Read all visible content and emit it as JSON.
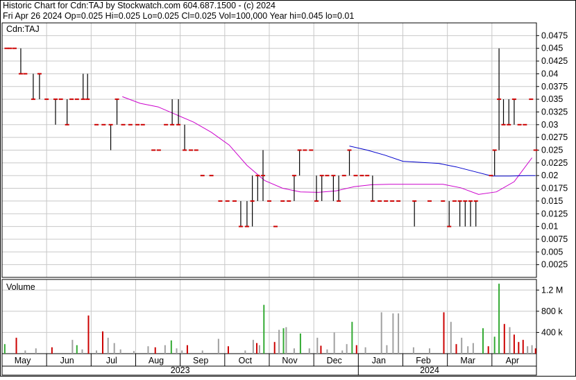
{
  "header": {
    "line1": "Historic Chart for Cdn:TAJ by Stockwatch.com 604.687.1500 - (c) 2024",
    "line2": "Fri Apr 26 2024   Op=0.025  Hi=0.025  Lo=0.025  Cl=0.025  Vol=100,000  Year hi=0.045  lo=0.01"
  },
  "price_panel_label": "Cdn:TAJ",
  "volume_panel_label": "Volume",
  "colors": {
    "up_tick": "#000000",
    "close_tick": "#cc0000",
    "ma_short": "#cc00cc",
    "ma_long": "#0000cc",
    "vol_up": "#33aa33",
    "vol_down": "#cc0000",
    "vol_flat": "#a0a0a0",
    "grid": "#c8c8c8"
  },
  "chart_data": [
    {
      "type": "ohlc",
      "title": "Historic Chart for Cdn:TAJ",
      "ylim": [
        0,
        0.05
      ],
      "y_ticks": [
        "0.0475",
        "0.045",
        "0.0425",
        "0.04",
        "0.0375",
        "0.035",
        "0.0325",
        "0.03",
        "0.0275",
        "0.025",
        "0.0225",
        "0.02",
        "0.0175",
        "0.015",
        "0.0125",
        "0.01",
        "0.0075",
        "0.005",
        "0.0025"
      ],
      "x_months": [
        "May",
        "Jun",
        "Jul",
        "Aug",
        "Sep",
        "Oct",
        "Nov",
        "Dec",
        "Jan",
        "Feb",
        "Mar",
        "Apr"
      ],
      "x_years": [
        "2023",
        "2024"
      ],
      "bars": [
        {
          "t": 0.5,
          "hi": 0.045,
          "lo": 0.045,
          "cl": 0.045
        },
        {
          "t": 0.9,
          "hi": 0.045,
          "lo": 0.045,
          "cl": 0.045
        },
        {
          "t": 1.4,
          "hi": 0.045,
          "lo": 0.045,
          "cl": 0.045
        },
        {
          "t": 2.1,
          "hi": 0.045,
          "lo": 0.04,
          "cl": 0.04
        },
        {
          "t": 2.6,
          "hi": 0.04,
          "lo": 0.04,
          "cl": 0.04
        },
        {
          "t": 3.5,
          "hi": 0.04,
          "lo": 0.035,
          "cl": 0.035
        },
        {
          "t": 4.2,
          "hi": 0.04,
          "lo": 0.035,
          "cl": 0.04
        },
        {
          "t": 5.0,
          "hi": 0.035,
          "lo": 0.035,
          "cl": 0.035
        },
        {
          "t": 6.0,
          "hi": 0.035,
          "lo": 0.03,
          "cl": 0.035
        },
        {
          "t": 6.6,
          "hi": 0.035,
          "lo": 0.035,
          "cl": 0.035
        },
        {
          "t": 7.3,
          "hi": 0.035,
          "lo": 0.03,
          "cl": 0.03
        },
        {
          "t": 7.8,
          "hi": 0.035,
          "lo": 0.035,
          "cl": 0.035
        },
        {
          "t": 8.4,
          "hi": 0.035,
          "lo": 0.035,
          "cl": 0.035
        },
        {
          "t": 9.1,
          "hi": 0.04,
          "lo": 0.035,
          "cl": 0.035
        },
        {
          "t": 9.6,
          "hi": 0.04,
          "lo": 0.035,
          "cl": 0.035
        },
        {
          "t": 10.6,
          "hi": 0.03,
          "lo": 0.03,
          "cl": 0.03
        },
        {
          "t": 11.4,
          "hi": 0.03,
          "lo": 0.03,
          "cl": 0.03
        },
        {
          "t": 12.2,
          "hi": 0.03,
          "lo": 0.025,
          "cl": 0.03
        },
        {
          "t": 12.9,
          "hi": 0.035,
          "lo": 0.03,
          "cl": 0.035
        },
        {
          "t": 13.6,
          "hi": 0.03,
          "lo": 0.03,
          "cl": 0.03
        },
        {
          "t": 14.4,
          "hi": 0.03,
          "lo": 0.03,
          "cl": 0.03
        },
        {
          "t": 15.2,
          "hi": 0.03,
          "lo": 0.03,
          "cl": 0.03
        },
        {
          "t": 15.8,
          "hi": 0.03,
          "lo": 0.03,
          "cl": 0.03
        },
        {
          "t": 17.0,
          "hi": 0.025,
          "lo": 0.025,
          "cl": 0.025
        },
        {
          "t": 17.6,
          "hi": 0.025,
          "lo": 0.025,
          "cl": 0.025
        },
        {
          "t": 18.4,
          "hi": 0.03,
          "lo": 0.03,
          "cl": 0.03
        },
        {
          "t": 19.1,
          "hi": 0.035,
          "lo": 0.03,
          "cl": 0.03
        },
        {
          "t": 19.8,
          "hi": 0.035,
          "lo": 0.03,
          "cl": 0.03
        },
        {
          "t": 20.5,
          "hi": 0.03,
          "lo": 0.025,
          "cl": 0.025
        },
        {
          "t": 21.2,
          "hi": 0.025,
          "lo": 0.025,
          "cl": 0.025
        },
        {
          "t": 21.8,
          "hi": 0.025,
          "lo": 0.025,
          "cl": 0.025
        },
        {
          "t": 22.5,
          "hi": 0.02,
          "lo": 0.02,
          "cl": 0.02
        },
        {
          "t": 23.5,
          "hi": 0.02,
          "lo": 0.02,
          "cl": 0.02
        },
        {
          "t": 24.5,
          "hi": 0.015,
          "lo": 0.015,
          "cl": 0.015
        },
        {
          "t": 25.3,
          "hi": 0.015,
          "lo": 0.015,
          "cl": 0.015
        },
        {
          "t": 26.1,
          "hi": 0.015,
          "lo": 0.015,
          "cl": 0.015
        },
        {
          "t": 26.8,
          "hi": 0.015,
          "lo": 0.01,
          "cl": 0.01
        },
        {
          "t": 27.5,
          "hi": 0.015,
          "lo": 0.01,
          "cl": 0.01
        },
        {
          "t": 28.1,
          "hi": 0.02,
          "lo": 0.01,
          "cl": 0.015
        },
        {
          "t": 28.7,
          "hi": 0.02,
          "lo": 0.015,
          "cl": 0.02
        },
        {
          "t": 29.3,
          "hi": 0.025,
          "lo": 0.015,
          "cl": 0.02
        },
        {
          "t": 30.0,
          "hi": 0.015,
          "lo": 0.015,
          "cl": 0.015
        },
        {
          "t": 30.7,
          "hi": 0.01,
          "lo": 0.01,
          "cl": 0.01
        },
        {
          "t": 31.5,
          "hi": 0.015,
          "lo": 0.015,
          "cl": 0.015
        },
        {
          "t": 32.2,
          "hi": 0.015,
          "lo": 0.015,
          "cl": 0.015
        },
        {
          "t": 32.8,
          "hi": 0.02,
          "lo": 0.015,
          "cl": 0.02
        },
        {
          "t": 33.4,
          "hi": 0.025,
          "lo": 0.02,
          "cl": 0.025
        },
        {
          "t": 34.0,
          "hi": 0.025,
          "lo": 0.025,
          "cl": 0.025
        },
        {
          "t": 34.7,
          "hi": 0.025,
          "lo": 0.025,
          "cl": 0.025
        },
        {
          "t": 35.3,
          "hi": 0.02,
          "lo": 0.015,
          "cl": 0.015
        },
        {
          "t": 35.9,
          "hi": 0.02,
          "lo": 0.015,
          "cl": 0.02
        },
        {
          "t": 36.5,
          "hi": 0.02,
          "lo": 0.02,
          "cl": 0.02
        },
        {
          "t": 37.2,
          "hi": 0.02,
          "lo": 0.015,
          "cl": 0.02
        },
        {
          "t": 37.8,
          "hi": 0.02,
          "lo": 0.015,
          "cl": 0.015
        },
        {
          "t": 38.4,
          "hi": 0.02,
          "lo": 0.02,
          "cl": 0.02
        },
        {
          "t": 39.0,
          "hi": 0.025,
          "lo": 0.02,
          "cl": 0.025
        },
        {
          "t": 39.7,
          "hi": 0.02,
          "lo": 0.02,
          "cl": 0.02
        },
        {
          "t": 40.4,
          "hi": 0.02,
          "lo": 0.02,
          "cl": 0.02
        },
        {
          "t": 41.0,
          "hi": 0.02,
          "lo": 0.02,
          "cl": 0.02
        },
        {
          "t": 41.6,
          "hi": 0.02,
          "lo": 0.015,
          "cl": 0.015
        },
        {
          "t": 42.4,
          "hi": 0.015,
          "lo": 0.015,
          "cl": 0.015
        },
        {
          "t": 43.1,
          "hi": 0.015,
          "lo": 0.015,
          "cl": 0.015
        },
        {
          "t": 43.8,
          "hi": 0.015,
          "lo": 0.015,
          "cl": 0.015
        },
        {
          "t": 44.5,
          "hi": 0.015,
          "lo": 0.015,
          "cl": 0.015
        },
        {
          "t": 46.3,
          "hi": 0.015,
          "lo": 0.01,
          "cl": 0.015
        },
        {
          "t": 48.0,
          "hi": 0.015,
          "lo": 0.015,
          "cl": 0.015
        },
        {
          "t": 49.5,
          "hi": 0.015,
          "lo": 0.015,
          "cl": 0.015
        },
        {
          "t": 50.2,
          "hi": 0.015,
          "lo": 0.01,
          "cl": 0.01
        },
        {
          "t": 50.8,
          "hi": 0.015,
          "lo": 0.015,
          "cl": 0.015
        },
        {
          "t": 51.4,
          "hi": 0.015,
          "lo": 0.01,
          "cl": 0.015
        },
        {
          "t": 52.0,
          "hi": 0.015,
          "lo": 0.01,
          "cl": 0.015
        },
        {
          "t": 52.6,
          "hi": 0.015,
          "lo": 0.01,
          "cl": 0.015
        },
        {
          "t": 53.2,
          "hi": 0.015,
          "lo": 0.01,
          "cl": 0.015
        },
        {
          "t": 54.9,
          "hi": 0.02,
          "lo": 0.02,
          "cl": 0.02
        },
        {
          "t": 55.3,
          "hi": 0.025,
          "lo": 0.02,
          "cl": 0.025
        },
        {
          "t": 55.8,
          "hi": 0.045,
          "lo": 0.025,
          "cl": 0.035
        },
        {
          "t": 56.3,
          "hi": 0.035,
          "lo": 0.03,
          "cl": 0.03
        },
        {
          "t": 56.9,
          "hi": 0.035,
          "lo": 0.03,
          "cl": 0.03
        },
        {
          "t": 57.5,
          "hi": 0.035,
          "lo": 0.03,
          "cl": 0.035
        },
        {
          "t": 58.1,
          "hi": 0.03,
          "lo": 0.03,
          "cl": 0.03
        },
        {
          "t": 58.7,
          "hi": 0.03,
          "lo": 0.03,
          "cl": 0.03
        },
        {
          "t": 59.4,
          "hi": 0.035,
          "lo": 0.035,
          "cl": 0.035
        },
        {
          "t": 59.9,
          "hi": 0.025,
          "lo": 0.025,
          "cl": 0.025
        }
      ],
      "ma_short": [
        {
          "t": 13.5,
          "v": 0.0355
        },
        {
          "t": 15.5,
          "v": 0.0342
        },
        {
          "t": 17.5,
          "v": 0.0335
        },
        {
          "t": 19.5,
          "v": 0.032
        },
        {
          "t": 21.5,
          "v": 0.0305
        },
        {
          "t": 23.5,
          "v": 0.0285
        },
        {
          "t": 25.5,
          "v": 0.026
        },
        {
          "t": 27.5,
          "v": 0.022
        },
        {
          "t": 29.5,
          "v": 0.019
        },
        {
          "t": 31.5,
          "v": 0.0175
        },
        {
          "t": 33.5,
          "v": 0.0168
        },
        {
          "t": 35.5,
          "v": 0.0167
        },
        {
          "t": 37.5,
          "v": 0.017
        },
        {
          "t": 39.5,
          "v": 0.0178
        },
        {
          "t": 41.5,
          "v": 0.0182
        },
        {
          "t": 43.5,
          "v": 0.0183
        },
        {
          "t": 45.5,
          "v": 0.0183
        },
        {
          "t": 47.5,
          "v": 0.0183
        },
        {
          "t": 49.5,
          "v": 0.0183
        },
        {
          "t": 51.5,
          "v": 0.0176
        },
        {
          "t": 53.5,
          "v": 0.0163
        },
        {
          "t": 55.5,
          "v": 0.0168
        },
        {
          "t": 57.5,
          "v": 0.0188
        },
        {
          "t": 59.5,
          "v": 0.0235
        }
      ],
      "ma_long": [
        {
          "t": 39.0,
          "v": 0.0258
        },
        {
          "t": 41.0,
          "v": 0.025
        },
        {
          "t": 43.0,
          "v": 0.024
        },
        {
          "t": 45.0,
          "v": 0.0228
        },
        {
          "t": 47.0,
          "v": 0.0226
        },
        {
          "t": 49.0,
          "v": 0.0224
        },
        {
          "t": 51.0,
          "v": 0.0217
        },
        {
          "t": 53.0,
          "v": 0.0208
        },
        {
          "t": 55.0,
          "v": 0.0199
        },
        {
          "t": 57.0,
          "v": 0.0199
        },
        {
          "t": 59.0,
          "v": 0.02
        },
        {
          "t": 59.9,
          "v": 0.02
        }
      ]
    },
    {
      "type": "bar",
      "title": "Volume",
      "ylim": [
        0,
        1400000
      ],
      "y_ticks": [
        "400 k",
        "800 k",
        "1.2 M"
      ],
      "bars": [
        {
          "t": 0.3,
          "v": 180000,
          "c": "up"
        },
        {
          "t": 1.6,
          "v": 300000,
          "c": "down"
        },
        {
          "t": 2.6,
          "v": 60000,
          "c": "flat"
        },
        {
          "t": 3.8,
          "v": 100000,
          "c": "flat"
        },
        {
          "t": 5.6,
          "v": 120000,
          "c": "down"
        },
        {
          "t": 7.9,
          "v": 260000,
          "c": "flat"
        },
        {
          "t": 8.4,
          "v": 160000,
          "c": "up"
        },
        {
          "t": 9.0,
          "v": 80000,
          "c": "flat"
        },
        {
          "t": 9.7,
          "v": 720000,
          "c": "down"
        },
        {
          "t": 10.6,
          "v": 60000,
          "c": "flat"
        },
        {
          "t": 11.3,
          "v": 420000,
          "c": "down"
        },
        {
          "t": 11.9,
          "v": 300000,
          "c": "flat"
        },
        {
          "t": 12.6,
          "v": 200000,
          "c": "flat"
        },
        {
          "t": 13.3,
          "v": 80000,
          "c": "flat"
        },
        {
          "t": 14.8,
          "v": 50000,
          "c": "flat"
        },
        {
          "t": 16.4,
          "v": 140000,
          "c": "flat"
        },
        {
          "t": 17.2,
          "v": 120000,
          "c": "down"
        },
        {
          "t": 18.3,
          "v": 160000,
          "c": "flat"
        },
        {
          "t": 19.0,
          "v": 250000,
          "c": "up"
        },
        {
          "t": 19.6,
          "v": 100000,
          "c": "flat"
        },
        {
          "t": 20.2,
          "v": 60000,
          "c": "flat"
        },
        {
          "t": 20.8,
          "v": 160000,
          "c": "down"
        },
        {
          "t": 22.5,
          "v": 60000,
          "c": "flat"
        },
        {
          "t": 24.3,
          "v": 280000,
          "c": "flat"
        },
        {
          "t": 25.4,
          "v": 140000,
          "c": "down"
        },
        {
          "t": 27.3,
          "v": 60000,
          "c": "flat"
        },
        {
          "t": 28.2,
          "v": 260000,
          "c": "flat"
        },
        {
          "t": 28.6,
          "v": 200000,
          "c": "down"
        },
        {
          "t": 28.9,
          "v": 160000,
          "c": "flat"
        },
        {
          "t": 29.4,
          "v": 920000,
          "c": "up"
        },
        {
          "t": 30.6,
          "v": 220000,
          "c": "down"
        },
        {
          "t": 31.1,
          "v": 450000,
          "c": "flat"
        },
        {
          "t": 31.6,
          "v": 480000,
          "c": "up"
        },
        {
          "t": 31.9,
          "v": 500000,
          "c": "flat"
        },
        {
          "t": 32.8,
          "v": 100000,
          "c": "flat"
        },
        {
          "t": 33.5,
          "v": 380000,
          "c": "up"
        },
        {
          "t": 34.5,
          "v": 100000,
          "c": "flat"
        },
        {
          "t": 35.4,
          "v": 300000,
          "c": "flat"
        },
        {
          "t": 35.8,
          "v": 150000,
          "c": "down"
        },
        {
          "t": 36.5,
          "v": 80000,
          "c": "flat"
        },
        {
          "t": 37.3,
          "v": 400000,
          "c": "flat"
        },
        {
          "t": 38.2,
          "v": 60000,
          "c": "flat"
        },
        {
          "t": 38.7,
          "v": 180000,
          "c": "flat"
        },
        {
          "t": 39.3,
          "v": 600000,
          "c": "up"
        },
        {
          "t": 39.8,
          "v": 160000,
          "c": "down"
        },
        {
          "t": 40.8,
          "v": 120000,
          "c": "flat"
        },
        {
          "t": 42.6,
          "v": 780000,
          "c": "flat"
        },
        {
          "t": 43.2,
          "v": 160000,
          "c": "flat"
        },
        {
          "t": 43.9,
          "v": 760000,
          "c": "flat"
        },
        {
          "t": 44.5,
          "v": 760000,
          "c": "flat"
        },
        {
          "t": 46.2,
          "v": 120000,
          "c": "flat"
        },
        {
          "t": 48.0,
          "v": 100000,
          "c": "flat"
        },
        {
          "t": 49.6,
          "v": 780000,
          "c": "down"
        },
        {
          "t": 50.4,
          "v": 600000,
          "c": "flat"
        },
        {
          "t": 51.0,
          "v": 180000,
          "c": "down"
        },
        {
          "t": 51.6,
          "v": 300000,
          "c": "flat"
        },
        {
          "t": 52.3,
          "v": 140000,
          "c": "flat"
        },
        {
          "t": 52.9,
          "v": 200000,
          "c": "flat"
        },
        {
          "t": 54.0,
          "v": 480000,
          "c": "up"
        },
        {
          "t": 54.6,
          "v": 140000,
          "c": "down"
        },
        {
          "t": 55.3,
          "v": 320000,
          "c": "up"
        },
        {
          "t": 55.8,
          "v": 1320000,
          "c": "up"
        },
        {
          "t": 56.4,
          "v": 560000,
          "c": "down"
        },
        {
          "t": 57.0,
          "v": 500000,
          "c": "flat"
        },
        {
          "t": 57.5,
          "v": 360000,
          "c": "down"
        },
        {
          "t": 58.0,
          "v": 220000,
          "c": "down"
        },
        {
          "t": 58.5,
          "v": 260000,
          "c": "down"
        },
        {
          "t": 59.0,
          "v": 140000,
          "c": "flat"
        },
        {
          "t": 59.5,
          "v": 160000,
          "c": "flat"
        },
        {
          "t": 59.9,
          "v": 100000,
          "c": "down"
        }
      ]
    }
  ]
}
